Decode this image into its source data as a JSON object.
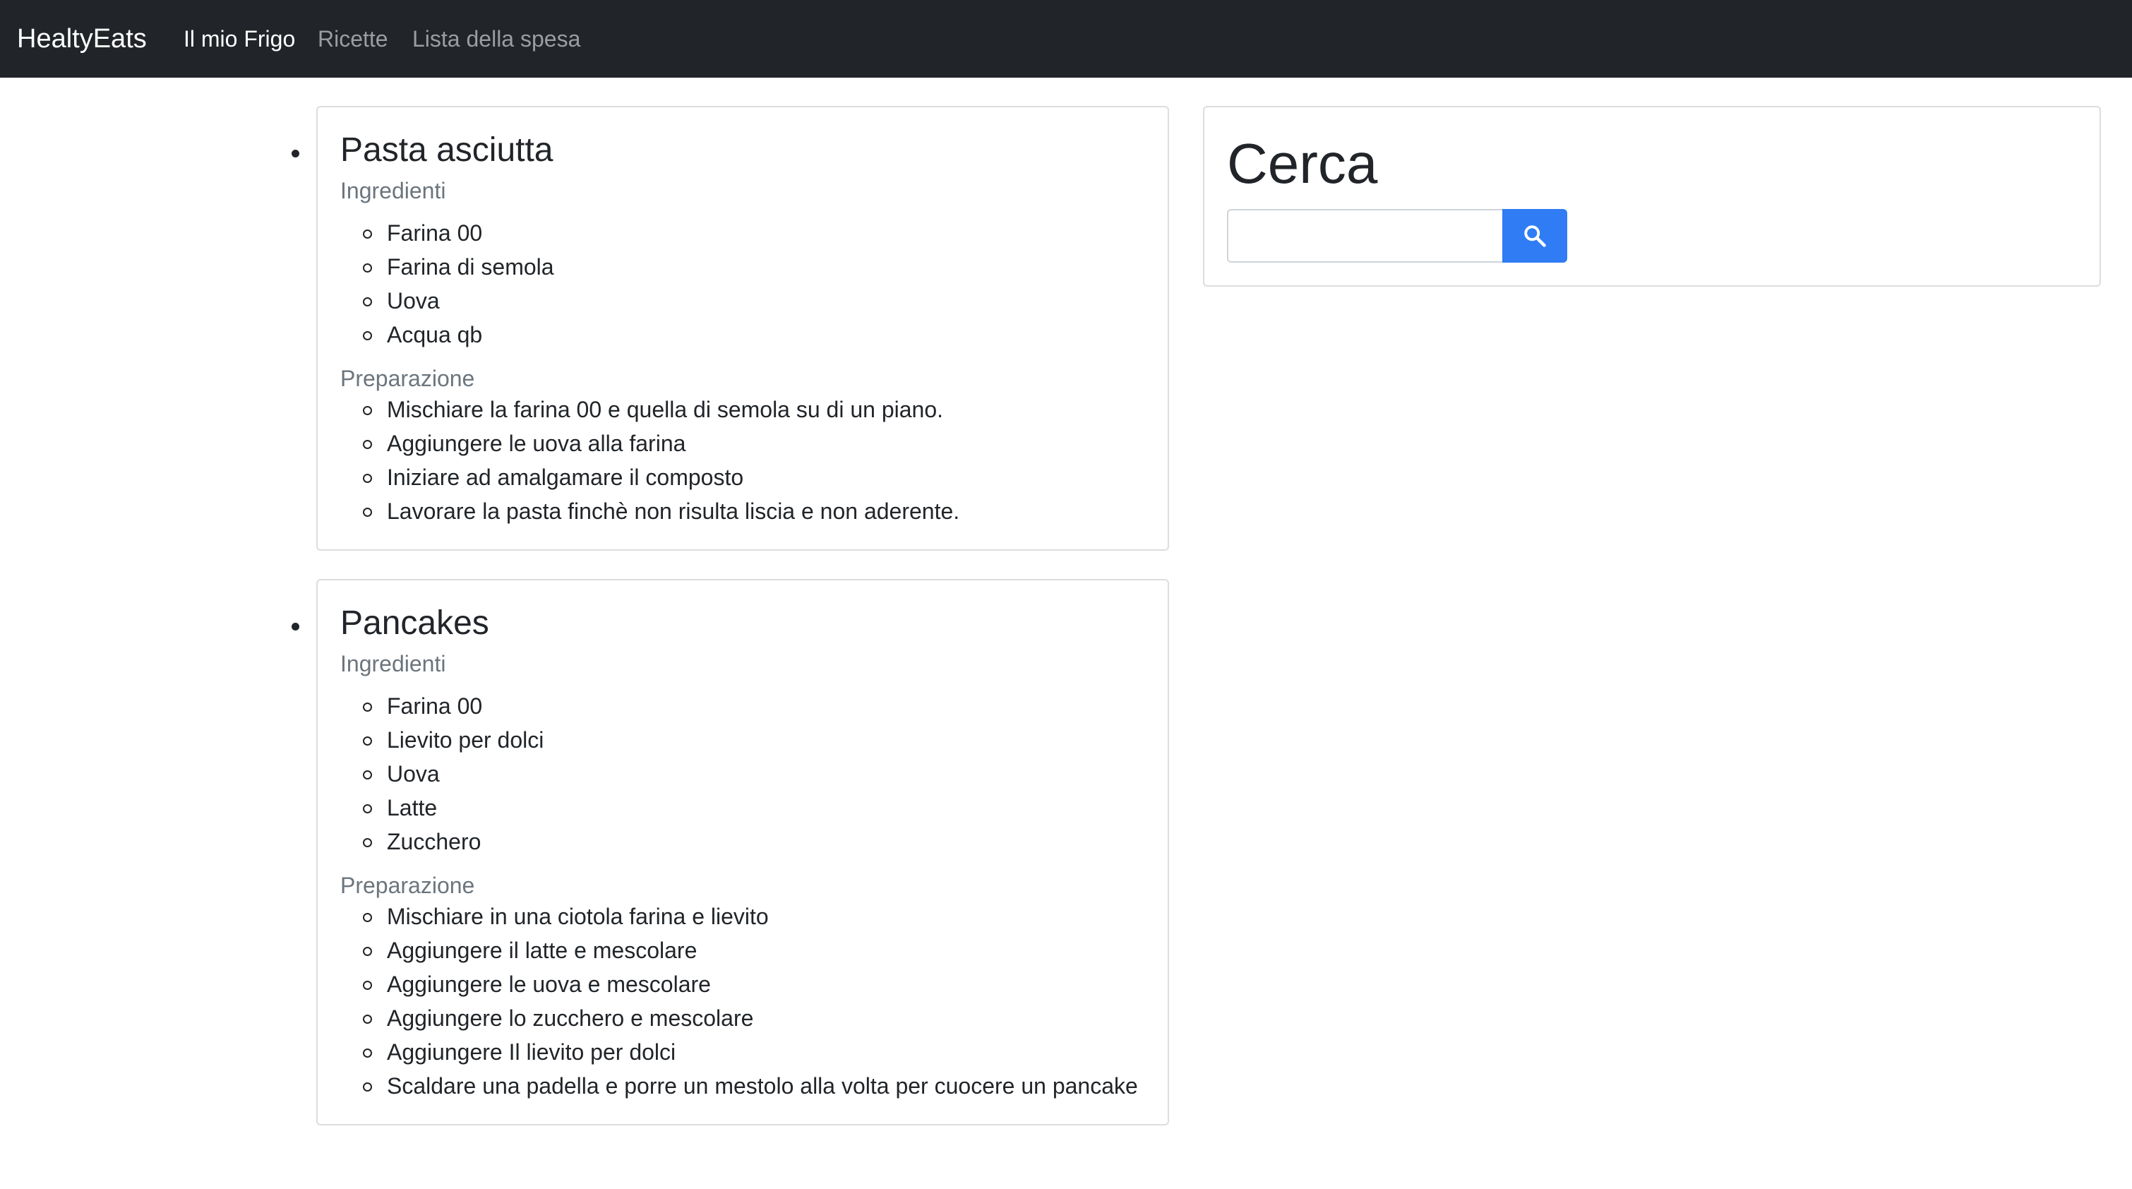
{
  "navbar": {
    "brand": "HealtyEats",
    "links": [
      {
        "label": "Il mio Frigo",
        "active": true
      },
      {
        "label": "Ricette",
        "active": false
      },
      {
        "label": "Lista della spesa",
        "active": false
      }
    ]
  },
  "recipes": [
    {
      "title": "Pasta asciutta",
      "ingredients_label": "Ingredienti",
      "ingredients": [
        "Farina 00",
        "Farina di semola",
        "Uova",
        "Acqua qb"
      ],
      "preparation_label": "Preparazione",
      "steps": [
        "Mischiare la farina 00 e quella di semola su di un piano.",
        "Aggiungere le uova alla farina",
        "Iniziare ad amalgamare il composto",
        "Lavorare la pasta finchè non risulta liscia e non aderente."
      ]
    },
    {
      "title": "Pancakes",
      "ingredients_label": "Ingredienti",
      "ingredients": [
        "Farina 00",
        "Lievito per dolci",
        "Uova",
        "Latte",
        "Zucchero"
      ],
      "preparation_label": "Preparazione",
      "steps": [
        "Mischiare in una ciotola farina e lievito",
        "Aggiungere il latte e mescolare",
        "Aggiungere le uova e mescolare",
        "Aggiungere lo zucchero e mescolare",
        "Aggiungere Il lievito per dolci",
        "Scaldare una padella e porre un mestolo alla volta per cuocere un pancake"
      ]
    }
  ],
  "search": {
    "title": "Cerca",
    "input_value": "",
    "placeholder": "",
    "button_icon": "search-icon",
    "button_color": "#2f7cf5"
  }
}
